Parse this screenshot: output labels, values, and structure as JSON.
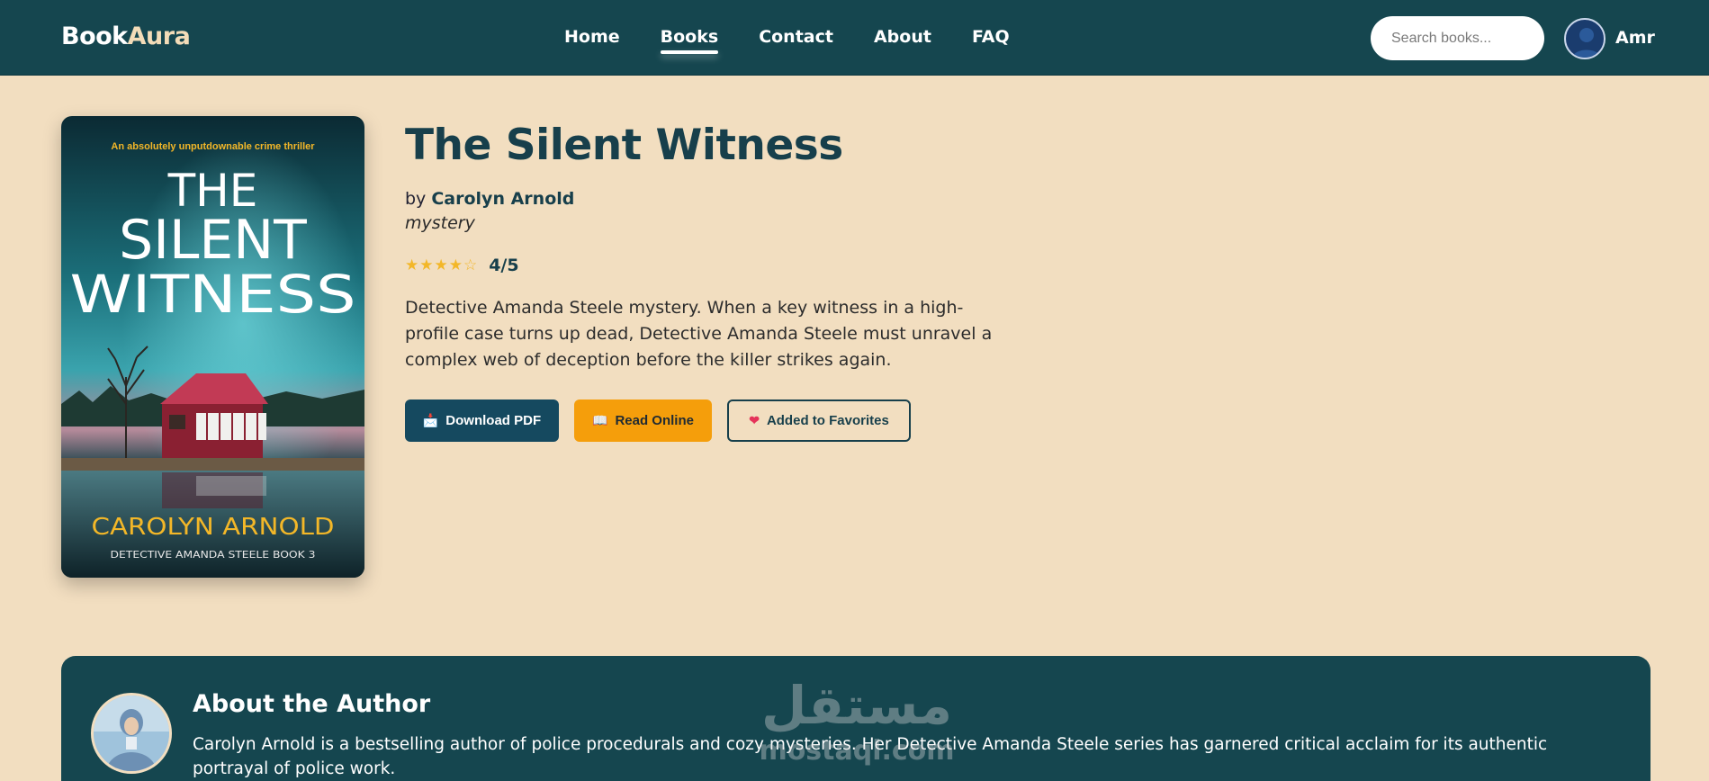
{
  "nav": {
    "logo_main": "Book",
    "logo_accent": "Aura",
    "links": [
      {
        "label": "Home"
      },
      {
        "label": "Books",
        "active": true
      },
      {
        "label": "Contact"
      },
      {
        "label": "About"
      },
      {
        "label": "FAQ"
      }
    ],
    "search_placeholder": "Search books...",
    "user_name": "Amr",
    "user_icon": "avatar-icon"
  },
  "book": {
    "cover": {
      "tagline": "An absolutely unputdownable crime thriller",
      "title_lines": [
        "THE",
        "SILENT",
        "WITNESS"
      ],
      "author": "CAROLYN ARNOLD",
      "series": "DETECTIVE AMANDA STEELE BOOK 3"
    },
    "title": "The Silent Witness",
    "by_label": "by",
    "author": "Carolyn Arnold",
    "genre": "mystery",
    "rating": {
      "stars": "★★★★☆",
      "value": 4,
      "max": 5,
      "label": "4/5"
    },
    "description": "Detective Amanda Steele mystery. When a key witness in a high-profile case turns up dead, Detective Amanda Steele must unravel a complex web of deception before the killer strikes again.",
    "actions": {
      "download": {
        "icon": "📩",
        "label": "Download PDF"
      },
      "read": {
        "icon": "📖",
        "label": "Read Online"
      },
      "favorite": {
        "icon": "❤",
        "label": "Added to Favorites"
      }
    }
  },
  "author_section": {
    "heading": "About the Author",
    "bio": "Carolyn Arnold is a bestselling author of police procedurals and cozy mysteries. Her Detective Amanda Steele series has garnered critical acclaim for its authentic portrayal of police work.",
    "photo_icon": "author-photo"
  },
  "watermark": {
    "arabic": "مستقل",
    "latin": "mostaql.com"
  },
  "colors": {
    "navbar_bg": "#15464f",
    "page_bg": "#f2dec0",
    "primary": "#15495f",
    "accent": "#f59e0b",
    "star": "#f3b728"
  }
}
